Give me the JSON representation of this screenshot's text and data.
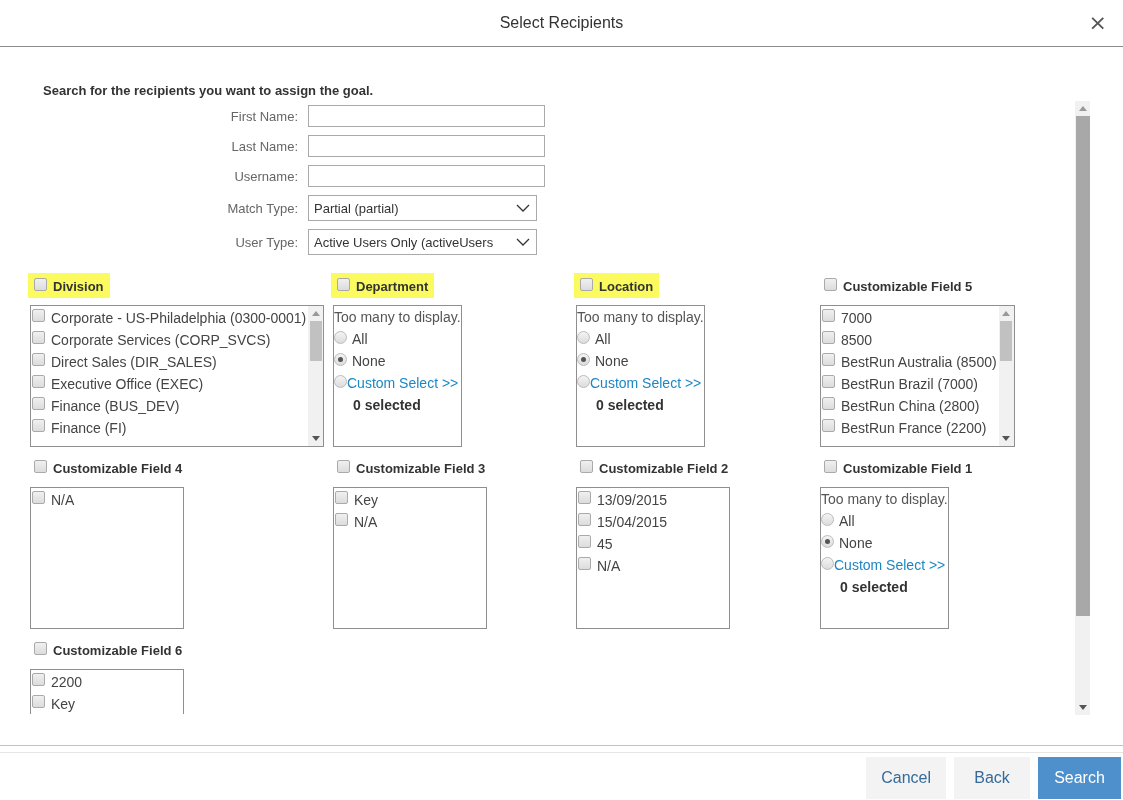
{
  "dialog": {
    "title": "Select Recipients",
    "close": "×"
  },
  "intro": "Search for the recipients you want to assign the goal.",
  "form": [
    {
      "label": "First Name:",
      "kind": "text"
    },
    {
      "label": "Last Name:",
      "kind": "text"
    },
    {
      "label": "Username:",
      "kind": "text"
    },
    {
      "label": "Match Type:",
      "kind": "select",
      "value": "Partial (partial)"
    },
    {
      "label": "User Type:",
      "kind": "select",
      "value": "Active Users Only (activeUsers"
    }
  ],
  "filters": [
    {
      "title": "Division",
      "checked": false,
      "highlighted": true,
      "kind": "list",
      "scrollable": true,
      "items": [
        {
          "label": "Corporate - US-Philadelphia (0300-0001)",
          "checked": false
        },
        {
          "label": "Corporate Services (CORP_SVCS)",
          "checked": false
        },
        {
          "label": "Direct Sales (DIR_SALES)",
          "checked": false
        },
        {
          "label": "Executive Office (EXEC)",
          "checked": false
        },
        {
          "label": "Finance (BUS_DEV)",
          "checked": false
        },
        {
          "label": "Finance (FI)",
          "checked": false
        }
      ]
    },
    {
      "title": "Department",
      "checked": false,
      "highlighted": true,
      "kind": "radio",
      "note": "Too many to display.",
      "options": [
        {
          "label": "All",
          "selected": false,
          "kind": "plain"
        },
        {
          "label": "None",
          "selected": true,
          "kind": "plain"
        },
        {
          "label": "Custom Select >>",
          "selected": false,
          "kind": "link"
        }
      ],
      "count": "0 selected"
    },
    {
      "title": "Location",
      "checked": false,
      "highlighted": true,
      "kind": "radio",
      "note": "Too many to display.",
      "options": [
        {
          "label": "All",
          "selected": false,
          "kind": "plain"
        },
        {
          "label": "None",
          "selected": true,
          "kind": "plain"
        },
        {
          "label": "Custom Select >>",
          "selected": false,
          "kind": "link"
        }
      ],
      "count": "0 selected"
    },
    {
      "title": "Customizable Field 5",
      "checked": false,
      "highlighted": false,
      "kind": "list",
      "scrollable": true,
      "items": [
        {
          "label": "7000",
          "checked": false
        },
        {
          "label": "8500",
          "checked": false
        },
        {
          "label": "BestRun Australia (8500)",
          "checked": false
        },
        {
          "label": "BestRun Brazil (7000)",
          "checked": false
        },
        {
          "label": "BestRun China (2800)",
          "checked": false
        },
        {
          "label": "BestRun France (2200)",
          "checked": false
        }
      ]
    },
    {
      "title": "Customizable Field 4",
      "checked": false,
      "highlighted": false,
      "kind": "list",
      "scrollable": false,
      "items": [
        {
          "label": "N/A",
          "checked": false
        }
      ]
    },
    {
      "title": "Customizable Field 3",
      "checked": false,
      "highlighted": false,
      "kind": "list",
      "scrollable": false,
      "items": [
        {
          "label": "Key",
          "checked": false
        },
        {
          "label": "N/A",
          "checked": false
        }
      ]
    },
    {
      "title": "Customizable Field 2",
      "checked": false,
      "highlighted": false,
      "kind": "list",
      "scrollable": false,
      "items": [
        {
          "label": "13/09/2015",
          "checked": false
        },
        {
          "label": "15/04/2015",
          "checked": false
        },
        {
          "label": "45",
          "checked": false
        },
        {
          "label": "N/A",
          "checked": false
        }
      ]
    },
    {
      "title": "Customizable Field 1",
      "checked": false,
      "highlighted": false,
      "kind": "radio",
      "note": "Too many to display.",
      "options": [
        {
          "label": "All",
          "selected": false,
          "kind": "plain"
        },
        {
          "label": "None",
          "selected": true,
          "kind": "plain"
        },
        {
          "label": "Custom Select >>",
          "selected": false,
          "kind": "link"
        }
      ],
      "count": "0 selected"
    },
    {
      "title": "Customizable Field 6",
      "checked": false,
      "highlighted": false,
      "kind": "list",
      "scrollable": false,
      "items": [
        {
          "label": "2200",
          "checked": false
        },
        {
          "label": "Key",
          "checked": false
        }
      ]
    }
  ],
  "buttons": [
    {
      "label": "Cancel",
      "kind": "secondary"
    },
    {
      "label": "Back",
      "kind": "secondary"
    },
    {
      "label": "Search",
      "kind": "primary"
    }
  ]
}
